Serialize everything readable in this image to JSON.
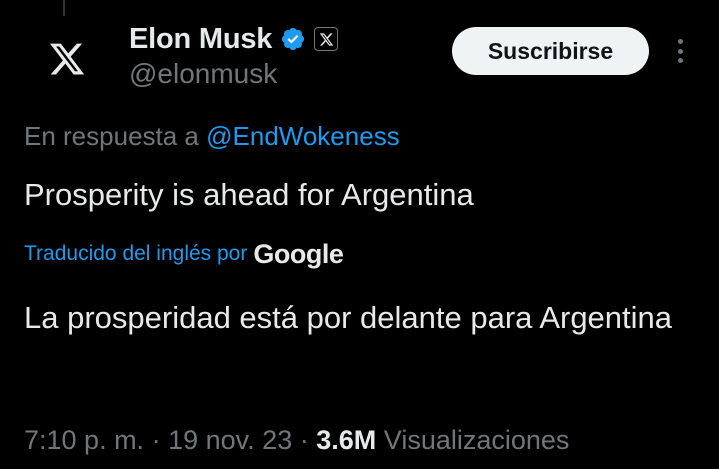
{
  "author": {
    "display_name": "Elon Musk",
    "handle": "@elonmusk",
    "avatar_icon": "x-logo-icon",
    "verified_icon": "verified-badge-icon",
    "affiliation_icon": "x-affiliation-icon"
  },
  "actions": {
    "subscribe_label": "Suscribirse",
    "more_icon": "more-vertical-icon"
  },
  "reply": {
    "prefix": "En respuesta a",
    "mention": "@EndWokeness"
  },
  "tweet": {
    "text": "Prosperity is ahead for Argentina",
    "translated_label": "Traducido del inglés por",
    "translation_provider": "Google",
    "translated_text": "La prosperidad está por delante para Argentina"
  },
  "meta": {
    "time": "7:10 p. m.",
    "separator": "·",
    "date": "19 nov. 23",
    "views_count": "3.6M",
    "views_label": "Visualizaciones"
  },
  "colors": {
    "background": "#000000",
    "text_primary": "#e7e9ea",
    "text_secondary": "#71767b",
    "accent": "#1d9bf0",
    "button_bg": "#eff3f4"
  }
}
